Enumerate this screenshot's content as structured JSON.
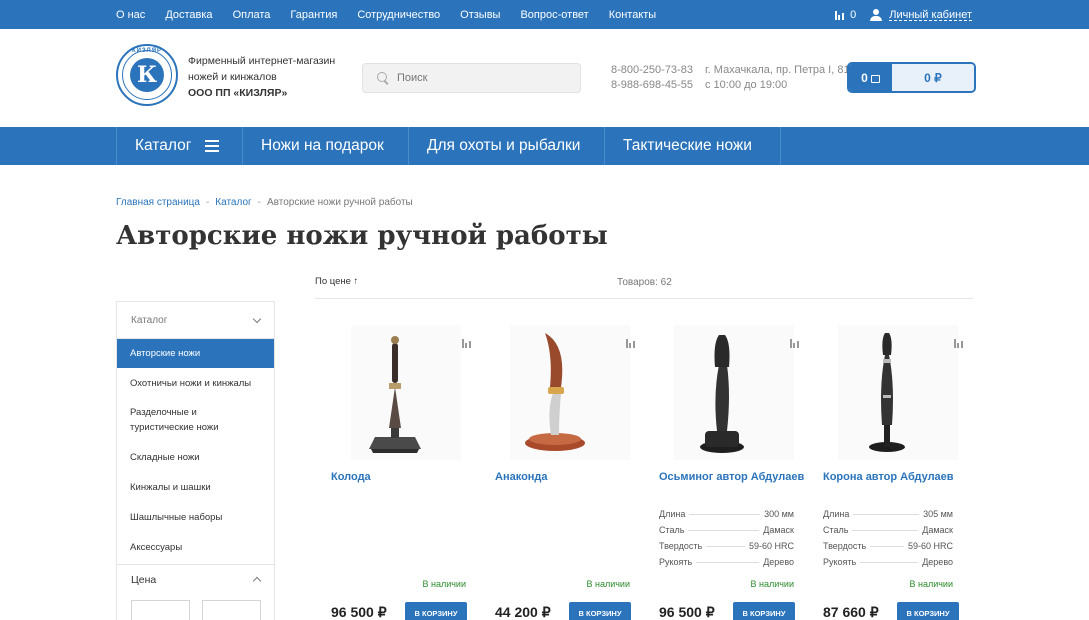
{
  "topbar": {
    "links": [
      "О нас",
      "Доставка",
      "Оплата",
      "Гарантия",
      "Сотрудничество",
      "Отзывы",
      "Вопрос-ответ",
      "Контакты"
    ],
    "compare_count": "0",
    "cabinet": "Личный кабинет",
    "bg_color": "#2b74bb"
  },
  "header": {
    "logo_letter": "К",
    "logo_ring_text": "КИЗЛЯР",
    "tagline_line1": "Фирменный интернет-магазин",
    "tagline_line2": "ножей и кинжалов",
    "tagline_line3": "ООО ПП «КИЗЛЯР»",
    "search_placeholder": "Поиск",
    "phone1": "8-800-250-73-83",
    "phone2": "8-988-698-45-55",
    "address": "г. Махачкала, пр. Петра I, 81",
    "hours": "с 10:00 до 19:00",
    "cart_count": "0",
    "cart_sum": "0 ₽"
  },
  "mainnav": {
    "items": [
      "Каталог",
      "Ножи на подарок",
      "Для охоты и рыбалки",
      "Тактические ножи"
    ]
  },
  "breadcrumbs": {
    "home": "Главная страница",
    "catalog": "Каталог",
    "current": "Авторские ножи ручной работы"
  },
  "page_title": "Авторские ножи ручной работы",
  "sidebar": {
    "head": "Каталог",
    "items": [
      "Авторские ножи",
      "Охотничьи ножи и кинжалы",
      "Разделочные и туристические ножи",
      "Складные ножи",
      "Кинжалы и шашки",
      "Шашлычные наборы",
      "Аксессуары"
    ],
    "active_index": 0,
    "price_head": "Цена"
  },
  "listing": {
    "sort_label": "По цене ↑",
    "count_label": "Товаров: 62"
  },
  "products": [
    {
      "name": "Колода",
      "stock": "В наличии",
      "price": "96 500 ₽",
      "buy": "В корзину",
      "specs": []
    },
    {
      "name": "Анаконда",
      "stock": "В наличии",
      "price": "44 200 ₽",
      "buy": "В корзину",
      "specs": []
    },
    {
      "name": "Осьминог автор Абдулаев",
      "stock": "В наличии",
      "price": "96 500 ₽",
      "buy": "В корзину",
      "specs": [
        {
          "k": "Длина",
          "v": "300 мм"
        },
        {
          "k": "Сталь",
          "v": "Дамаск"
        },
        {
          "k": "Твердость",
          "v": "59-60 HRC"
        },
        {
          "k": "Рукоять",
          "v": "Дерево"
        }
      ]
    },
    {
      "name": "Корона автор Абдулаев",
      "stock": "В наличии",
      "price": "87 660 ₽",
      "buy": "В корзину",
      "specs": [
        {
          "k": "Длина",
          "v": "305 мм"
        },
        {
          "k": "Сталь",
          "v": "Дамаск"
        },
        {
          "k": "Твердость",
          "v": "59-60 HRC"
        },
        {
          "k": "Рукоять",
          "v": "Дерево"
        }
      ]
    }
  ]
}
